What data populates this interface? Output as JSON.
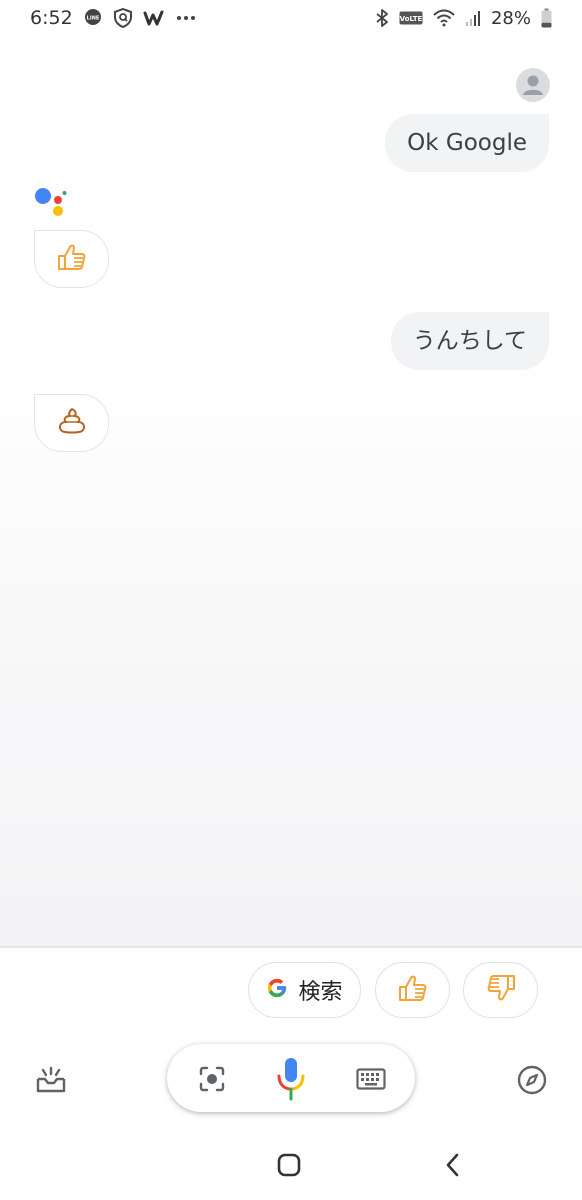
{
  "status_bar": {
    "time": "6:52",
    "left_icons": [
      "line-icon",
      "vpn-shield-icon",
      "w-app-icon",
      "more-dots-icon"
    ],
    "right_icons": [
      "bluetooth-icon",
      "volte-icon",
      "wifi-icon",
      "signal-icon",
      "battery-icon"
    ],
    "volte_label": "VoLTE",
    "battery_percent": "28%",
    "battery_level": 0.28
  },
  "conversation": {
    "messages": [
      {
        "role": "user",
        "text": "Ok Google"
      },
      {
        "role": "assistant",
        "icon": "thumbs-up-icon"
      },
      {
        "role": "user",
        "text": "うんちして"
      },
      {
        "role": "assistant",
        "icon": "poop-icon"
      }
    ]
  },
  "suggestions": {
    "search_label": "検索",
    "chips": [
      "google-search-chip",
      "thumbs-up-chip",
      "thumbs-down-chip"
    ]
  },
  "action_bar": {
    "left_icon": "updates-tray-icon",
    "pill_icons": [
      "lens-icon",
      "mic-icon",
      "keyboard-icon"
    ],
    "right_icon": "explore-compass-icon"
  },
  "nav_bar": {
    "buttons": [
      "home-button",
      "back-button"
    ]
  },
  "colors": {
    "google_blue": "#4285F4",
    "google_red": "#EA4335",
    "google_yellow": "#FBBC05",
    "google_green": "#34A853",
    "emoji_orange": "#F2A33A",
    "bubble_gray": "#F1F3F4"
  }
}
